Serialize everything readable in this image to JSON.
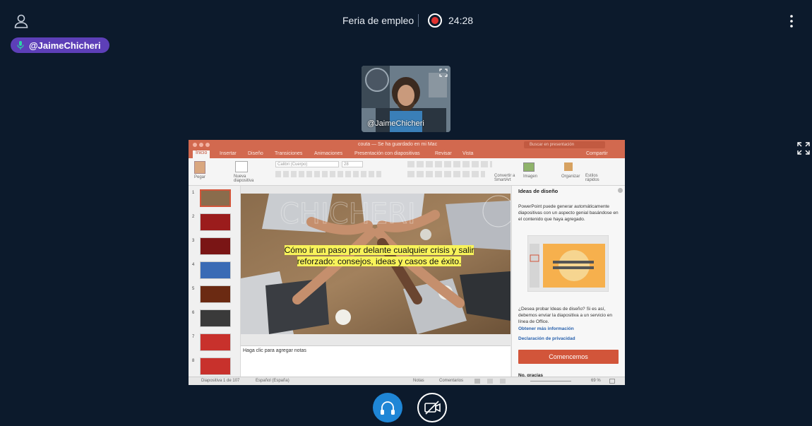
{
  "meeting": {
    "title": "Feria de empleo",
    "recording_time": "24:28"
  },
  "speaker": {
    "label": "@JaimeChicheri"
  },
  "camera": {
    "name": "@JaimeChicheri"
  },
  "ppt": {
    "title_bar": "couta — Se ha guardado en mi Mac",
    "search_placeholder": "Buscar en presentación",
    "tabs": [
      "Inicio",
      "Insertar",
      "Diseño",
      "Transiciones",
      "Animaciones",
      "Presentación con diapositivas",
      "Revisar",
      "Vista"
    ],
    "share": "Compartir",
    "ribbon": {
      "paste": "Pegar",
      "new_slide": "Nueva diapositiva",
      "font": "Calibri (Cuerpo)",
      "size": "28",
      "convert": "Convertir a SmartArt",
      "image": "Imagen",
      "arrange": "Organizar",
      "quick_styles": "Estilos rápidos"
    },
    "thumb_numbers": [
      "1",
      "2",
      "3",
      "4",
      "5",
      "6",
      "7",
      "8"
    ],
    "slide_caption": "Cómo ir un paso por delante  cualquier crisis y salir reforzado: consejos, ideas y casos de éxito.",
    "notes_placeholder": "Haga clic para agregar notas",
    "design_ideas": {
      "title": "Ideas de diseño",
      "description": "PowerPoint puede generar automáticamente diapositivas con un aspecto genial basándose en el contenido que haya agregado.",
      "question": "¿Desea probar Ideas de diseño? Si es así, debemos enviar la diapositiva a un servicio en línea de Office.",
      "more_info": "Obtener más información",
      "privacy": "Declaración de privacidad",
      "start": "Comencemos",
      "no_thanks": "No, gracias"
    },
    "status": {
      "slide": "Diapositiva 1 de 107",
      "language": "Español (España)",
      "notes": "Notas",
      "comments": "Comentarios",
      "zoom": "69 %"
    }
  },
  "colors": {
    "background": "#0c1a2c",
    "ppt_accent": "#d2694f",
    "audio_button": "#1f86d6",
    "record": "#e0322f",
    "speaker_pill": "#5d3fb8"
  }
}
